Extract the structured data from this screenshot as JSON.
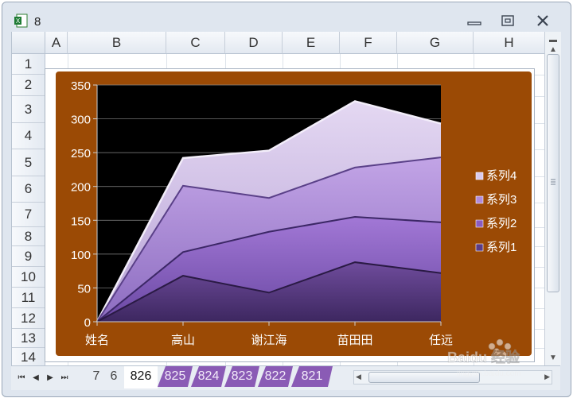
{
  "window": {
    "title": "8"
  },
  "columns": [
    "A",
    "B",
    "C",
    "D",
    "E",
    "F",
    "G",
    "H"
  ],
  "rows": [
    "1",
    "2",
    "3",
    "4",
    "5",
    "6",
    "7",
    "8",
    "9",
    "10",
    "11",
    "12",
    "13",
    "14"
  ],
  "sheet_tabs": [
    "7",
    "6",
    "826",
    "825",
    "824",
    "823",
    "822",
    "821"
  ],
  "active_tab": "826",
  "colors": {
    "chart_bg": "#9b4a05",
    "plot_bg": "#000000",
    "tab_purple": "#8a5bb5"
  },
  "chart_data": {
    "type": "area",
    "stacked": true,
    "categories": [
      "姓名",
      "高山",
      "谢江海",
      "苗田田",
      "任远"
    ],
    "series": [
      {
        "name": "系列1",
        "values": [
          0,
          68,
          43,
          88,
          72
        ]
      },
      {
        "name": "系列2",
        "values": [
          0,
          35,
          90,
          67,
          75
        ]
      },
      {
        "name": "系列3",
        "values": [
          0,
          98,
          50,
          73,
          96
        ]
      },
      {
        "name": "系列4",
        "values": [
          0,
          41,
          70,
          98,
          50
        ]
      }
    ],
    "ylim": [
      0,
      350
    ],
    "yticks": [
      "0",
      "50",
      "100",
      "150",
      "200",
      "250",
      "300",
      "350"
    ],
    "grid": true,
    "legend_position": "right"
  },
  "watermark": {
    "text": "Baidu 经验",
    "subtext": "jingyan.baidu.com"
  }
}
